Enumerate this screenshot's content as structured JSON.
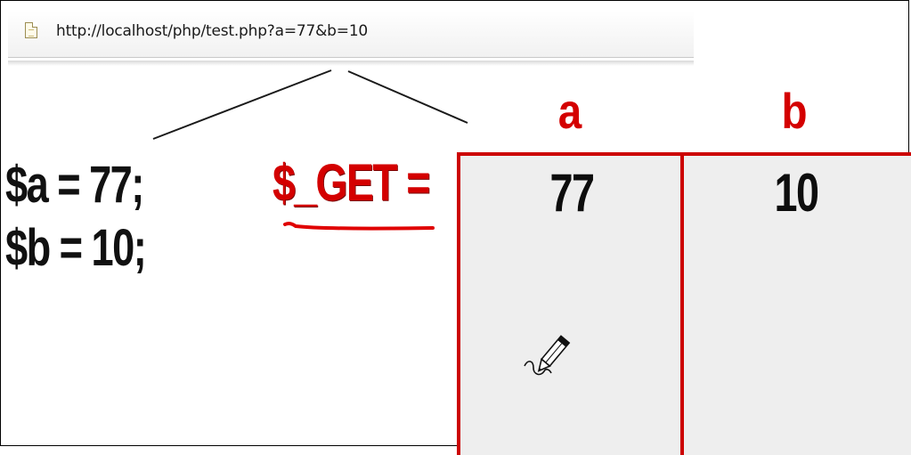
{
  "browser": {
    "url": "http://localhost/php/test.php?a=77&b=10",
    "page_icon": "document-icon"
  },
  "variables": {
    "a_line": "$a = 77;",
    "b_line": "$b = 10;"
  },
  "get_array": {
    "label": "$_GET =",
    "columns": [
      {
        "key": "a",
        "value": "77"
      },
      {
        "key": "b",
        "value": "10"
      }
    ]
  },
  "colors": {
    "accent_red": "#d40000",
    "table_border": "#cc0000",
    "table_fill": "#eeeeee",
    "text_dark": "#111111"
  },
  "decorations": {
    "cursor_icon": "pencil-icon"
  }
}
